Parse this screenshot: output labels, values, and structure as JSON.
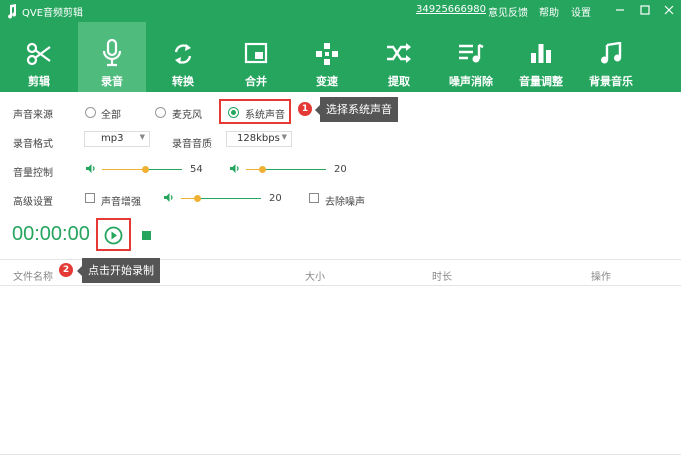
{
  "app": {
    "title": "QVE音频剪辑"
  },
  "titlebar": {
    "phone": "34925666980",
    "feedback": "意见反馈",
    "help": "帮助",
    "settings": "设置"
  },
  "toolbar": {
    "items": [
      {
        "label": "剪辑",
        "icon": "scissors-icon"
      },
      {
        "label": "录音",
        "icon": "microphone-icon",
        "active": true
      },
      {
        "label": "转换",
        "icon": "convert-icon"
      },
      {
        "label": "合并",
        "icon": "merge-icon"
      },
      {
        "label": "变速",
        "icon": "speed-icon"
      },
      {
        "label": "提取",
        "icon": "extract-icon"
      },
      {
        "label": "噪声消除",
        "icon": "noise-reduction-icon"
      },
      {
        "label": "音量调整",
        "icon": "volume-adjust-icon"
      },
      {
        "label": "背景音乐",
        "icon": "music-note-icon"
      }
    ]
  },
  "source": {
    "label": "声音来源",
    "options": [
      "全部",
      "麦克风",
      "系统声音"
    ],
    "selected": "系统声音"
  },
  "format": {
    "label": "录音格式",
    "value": "mp3",
    "quality_label": "录音音质",
    "quality_value": "128kbps"
  },
  "volume": {
    "label": "音量控制",
    "left_value": "54",
    "right_value": "20",
    "left_level": 54,
    "right_level": 20
  },
  "advanced": {
    "label": "高级设置",
    "enhance_label": "声音增强",
    "enhance_value": "20",
    "enhance_level": 20,
    "denoise_label": "去除噪声"
  },
  "recorder": {
    "time": "00:00:00"
  },
  "annotations": [
    {
      "number": "1",
      "text": "选择系统声音"
    },
    {
      "number": "2",
      "text": "点击开始录制"
    }
  ],
  "table": {
    "columns": [
      "文件名称",
      "大小",
      "时长",
      "操作"
    ]
  },
  "colors": {
    "primary": "#25a55e",
    "active_tab": "#4fbc7e",
    "slider": "#f0b033",
    "highlight": "#e53935"
  }
}
